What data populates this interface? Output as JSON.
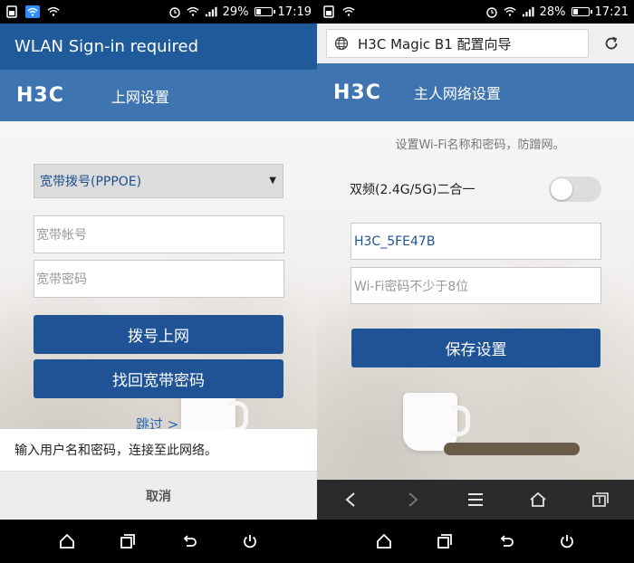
{
  "left": {
    "status": {
      "battery": "29%",
      "time": "17:19"
    },
    "title_bar": "WLAN Sign-in required",
    "header": {
      "logo": "H3C",
      "title": "上网设置"
    },
    "mode_select": {
      "value": "宽带拨号(PPPOE)"
    },
    "account_field": {
      "placeholder": "宽带帐号"
    },
    "password_field": {
      "placeholder": "宽带密码"
    },
    "dial_button": "拨号上网",
    "recover_button": "找回宽带密码",
    "skip_link": "跳过 >",
    "prompt_text": "输入用户名和密码，连接至此网络。",
    "cancel_button": "取消"
  },
  "right": {
    "status": {
      "battery": "28%",
      "time": "17:21"
    },
    "url_bar": {
      "text": "H3C Magic B1 配置向导"
    },
    "header": {
      "logo": "H3C",
      "title": "主人网络设置"
    },
    "subtitle": "设置Wi-Fi名称和密码，防蹭网。",
    "dual_band": {
      "label": "双频(2.4G/5G)二合一",
      "enabled": false
    },
    "ssid_field": {
      "value": "H3C_5FE47B"
    },
    "wifi_password_field": {
      "placeholder": "Wi-Fi密码不少于8位"
    },
    "save_button": "保存设置"
  },
  "colors": {
    "header_blue": "#3e74b0",
    "title_blue": "#1f5a9a",
    "button_blue": "#1f5396"
  },
  "icons": [
    "sim-icon",
    "wifi-icon",
    "alarm-icon",
    "signal-icon",
    "battery-icon",
    "globe-icon",
    "reload-icon",
    "back-icon",
    "forward-icon",
    "menu-icon",
    "home-icon",
    "tabs-icon",
    "power-icon"
  ]
}
